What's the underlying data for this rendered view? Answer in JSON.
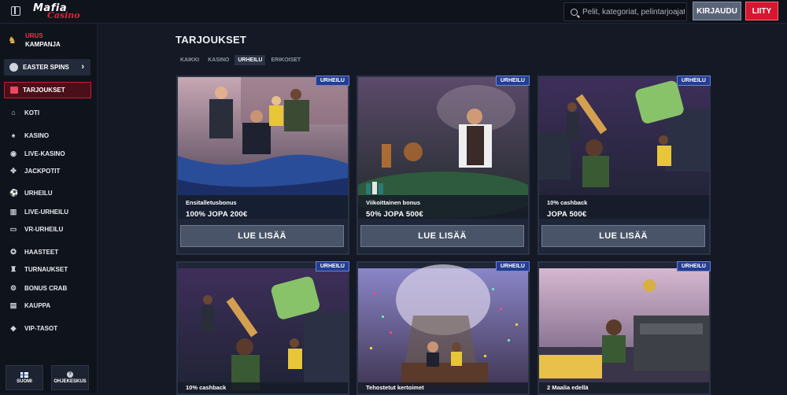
{
  "header": {
    "logo_main": "Mafia",
    "logo_sub": "Casino",
    "search_placeholder": "Pelit, kategoriat, pelintarjoajat",
    "login_label": "KIRJAUDU",
    "join_label": "LIITY"
  },
  "sidebar": {
    "promo_line1": "URUS",
    "promo_line2": "KAMPANJA",
    "easter_label": "EASTER SPINS",
    "offers_label": "TARJOUKSET",
    "items": [
      {
        "label": "KOTI",
        "icon": "home-icon",
        "glyph": "⌂"
      },
      {
        "label": "KASINO",
        "icon": "spade-icon",
        "glyph": "♠"
      },
      {
        "label": "LIVE-KASINO",
        "icon": "chip-icon",
        "glyph": "◉"
      },
      {
        "label": "JACKPOTIT",
        "icon": "clover-icon",
        "glyph": "✤"
      },
      {
        "label": "URHEILU",
        "icon": "ball-icon",
        "glyph": "⚽"
      },
      {
        "label": "LIVE-URHEILU",
        "icon": "chart-icon",
        "glyph": "▥"
      },
      {
        "label": "VR-URHEILU",
        "icon": "vr-icon",
        "glyph": "▭"
      },
      {
        "label": "HAASTEET",
        "icon": "badge-icon",
        "glyph": "✪"
      },
      {
        "label": "TURNAUKSET",
        "icon": "trophy-icon",
        "glyph": "♜"
      },
      {
        "label": "BONUS CRAB",
        "icon": "crab-icon",
        "glyph": "⚙"
      },
      {
        "label": "KAUPPA",
        "icon": "shop-icon",
        "glyph": "▤"
      },
      {
        "label": "VIP-TASOT",
        "icon": "diamond-icon",
        "glyph": "◆"
      }
    ],
    "language_label": "SUOMI",
    "help_label": "OHJEKESKUS"
  },
  "main": {
    "title": "TARJOUKSET",
    "tabs": [
      "KAIKKI",
      "KASINO",
      "URHEILU",
      "ERIKOISET"
    ],
    "active_tab": "URHEILU",
    "cards": [
      {
        "badge": "URHEILU",
        "subtitle": "Ensitalletusbonus",
        "title": "100% JOPA 200€",
        "cta": "LUE LISÄÄ"
      },
      {
        "badge": "URHEILU",
        "subtitle": "Viikoittainen bonus",
        "title": "50% JOPA 500€",
        "cta": "LUE LISÄÄ"
      },
      {
        "badge": "URHEILU",
        "subtitle": "10% cashback",
        "title": "JOPA 500€",
        "cta": "LUE LISÄÄ"
      },
      {
        "badge": "URHEILU",
        "subtitle": "10% cashback",
        "title": "",
        "cta": ""
      },
      {
        "badge": "URHEILU",
        "subtitle": "Tehostetut kertoimet",
        "title": "",
        "cta": ""
      },
      {
        "badge": "URHEILU",
        "subtitle": "2 Maalia edellä",
        "title": "",
        "cta": ""
      }
    ]
  },
  "colors": {
    "accent_red": "#d7162f",
    "badge_blue": "#243d8f",
    "bg": "#141925"
  }
}
